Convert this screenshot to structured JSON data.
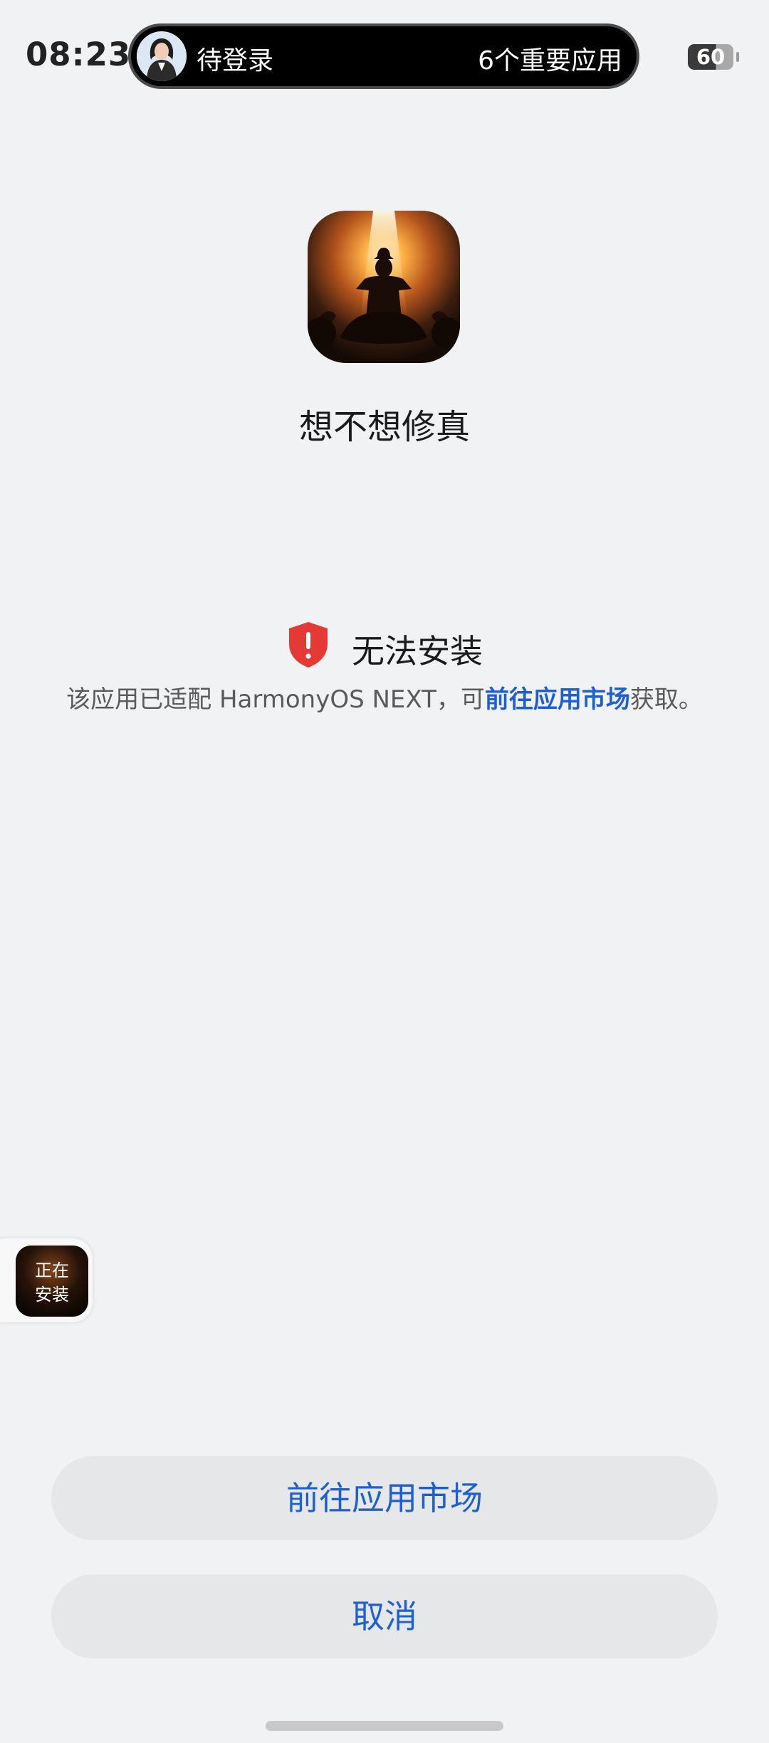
{
  "status_bar": {
    "time": "08:23",
    "capsule_label": "待登录",
    "capsule_right": "6个重要应用",
    "battery": "60"
  },
  "app": {
    "name": "想不想修真",
    "icon": "cultivator-silhouette-icon"
  },
  "warning": {
    "icon": "shield-alert-icon",
    "color": "#e53935",
    "title": "无法安装",
    "desc_prefix": "该应用已适配 HarmonyOS NEXT，可",
    "desc_link": "前往应用市场",
    "desc_suffix": "获取。"
  },
  "floating": {
    "line1": "正在",
    "line2": "安装"
  },
  "buttons": {
    "primary": "前往应用市场",
    "cancel": "取消"
  },
  "colors": {
    "background": "#f1f2f4",
    "accent": "#1d5fd6",
    "button_bg": "#e6e7e9"
  }
}
